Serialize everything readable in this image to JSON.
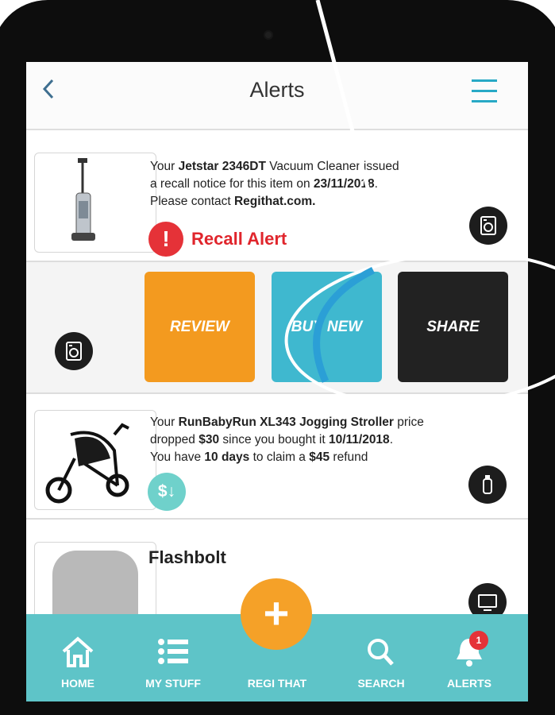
{
  "header": {
    "back_icon": "chevron-left-icon",
    "title": "Alerts",
    "menu_icon": "hamburger-menu-icon"
  },
  "alerts": [
    {
      "product_icon": "washing-machine-icon",
      "brand": "Jetstar 2346DT",
      "line1_pre": "Your ",
      "line1_post": " Vacuum Cleaner issued",
      "line2_pre": "a recall notice for this item on ",
      "date": "23/11/2018",
      "line2_post": ".",
      "line3_pre": "Please contact ",
      "contact": "Regithat.com.",
      "status": "Recall Alert",
      "status_icon": "exclamation-icon"
    },
    {
      "product_icon": "baby-bottle-icon",
      "brand": "RunBabyRun XL343 Jogging Stroller",
      "line1_pre": "Your ",
      "line1_post": " price",
      "line2_pre": "dropped ",
      "amount": "$30",
      "line2_mid": " since you bought it ",
      "date": "10/11/2018",
      "line2_post": ".",
      "line3_pre": "You have ",
      "days": "10 days",
      "line3_mid": " to claim a ",
      "refund": "$45",
      "line3_post": " refund",
      "status_icon": "price-drop-icon",
      "status_symbol": "$↓"
    },
    {
      "product_icon": "monitor-icon",
      "name": "Flashbolt"
    }
  ],
  "actions": {
    "review": "REVIEW",
    "buy_new": "BUY NEW",
    "share": "SHARE",
    "swipe_icon": "washing-machine-icon"
  },
  "tabs": [
    {
      "label": "HOME",
      "icon": "home-icon"
    },
    {
      "label": "MY STUFF",
      "icon": "list-icon"
    },
    {
      "label": "REGI THAT",
      "icon": "plus-icon"
    },
    {
      "label": "SEARCH",
      "icon": "search-icon"
    },
    {
      "label": "ALERTS",
      "icon": "bell-icon",
      "badge": "1"
    }
  ],
  "colors": {
    "accent": "#5ec4c8",
    "review": "#f39a1f",
    "buy_new": "#3fb8cf",
    "share": "#222222",
    "alert_red": "#e53238",
    "fab": "#f5a128"
  }
}
